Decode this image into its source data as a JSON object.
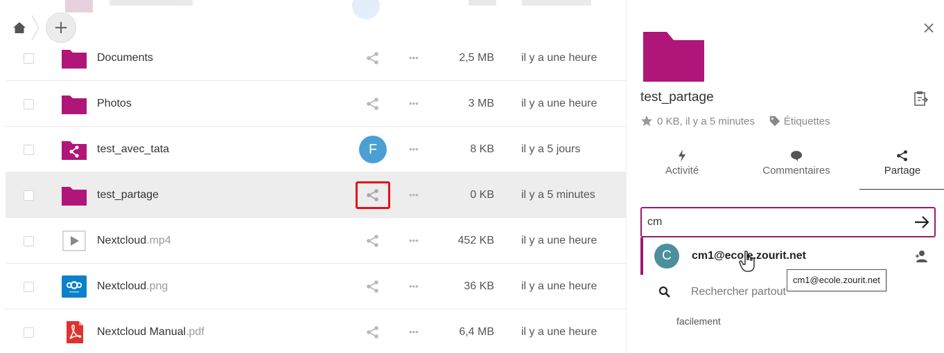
{
  "colors": {
    "folder": "#b0157a",
    "accent": "#9b1a6e",
    "highlight_box": "#e2111b",
    "avatar_blue": "#4a9fd5",
    "avatar_teal": "#4d8f9c"
  },
  "breadcrumb": {
    "home_icon": "home-icon",
    "add_label": "+"
  },
  "files": [
    {
      "name": "Documents",
      "ext": "",
      "icon": "folder-icon",
      "share": "share-icon",
      "actions": "•••",
      "size": "2,5 MB",
      "date": "il y a une heure"
    },
    {
      "name": "Photos",
      "ext": "",
      "icon": "folder-icon",
      "share": "share-icon",
      "actions": "•••",
      "size": "3 MB",
      "date": "il y a une heure"
    },
    {
      "name": "test_avec_tata",
      "ext": "",
      "icon": "shared-folder-icon",
      "share": "F",
      "actions": "•••",
      "size": "8 KB",
      "date": "il y a 5 jours"
    },
    {
      "name": "test_partage",
      "ext": "",
      "icon": "folder-icon",
      "share": "share-icon",
      "actions": "•••",
      "size": "0 KB",
      "date": "il y a 5 minutes"
    },
    {
      "name": "Nextcloud",
      "ext": ".mp4",
      "icon": "video-icon",
      "share": "share-icon",
      "actions": "•••",
      "size": "452 KB",
      "date": "il y a une heure"
    },
    {
      "name": "Nextcloud",
      "ext": ".png",
      "icon": "nextcloud-image-icon",
      "share": "share-icon",
      "actions": "•••",
      "size": "36 KB",
      "date": "il y a une heure"
    },
    {
      "name": "Nextcloud Manual",
      "ext": ".pdf",
      "icon": "pdf-icon",
      "share": "share-icon",
      "actions": "•••",
      "size": "6,4 MB",
      "date": "il y a une heure"
    }
  ],
  "sidebar": {
    "close": "×",
    "title": "test_partage",
    "meta": "0 KB, il y a 5 minutes",
    "tags_label": "Étiquettes",
    "tabs": [
      {
        "label": "Activité",
        "icon": "lightning-icon"
      },
      {
        "label": "Commentaires",
        "icon": "comment-icon"
      },
      {
        "label": "Partage",
        "icon": "share-icon"
      }
    ],
    "share_input": {
      "value": "cm"
    },
    "suggestion": {
      "avatar_letter": "C",
      "email": "cm1@ecole.zourit.net"
    },
    "search_everywhere": "Rechercher partout",
    "tooltip": "cm1@ecole.zourit.net",
    "footer_text": "facilement"
  }
}
